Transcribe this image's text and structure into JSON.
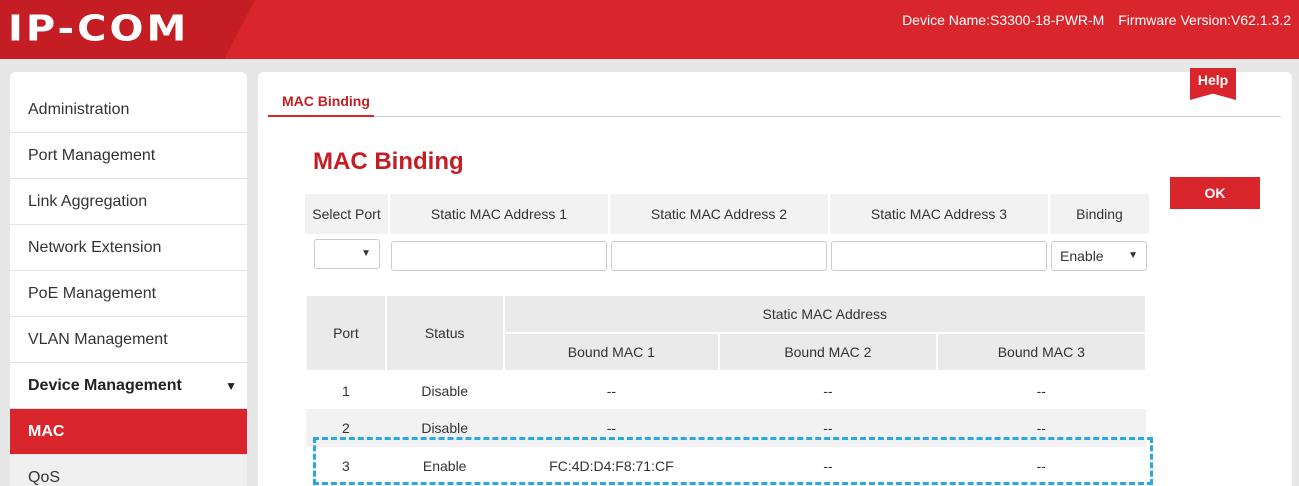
{
  "header": {
    "logo": "IP-COM",
    "device_name": "Device Name:S3300-18-PWR-M",
    "firmware": "Firmware Version:V62.1.3.2"
  },
  "sidebar": {
    "items": [
      {
        "label": "Administration"
      },
      {
        "label": "Port Management"
      },
      {
        "label": "Link Aggregation"
      },
      {
        "label": "Network Extension"
      },
      {
        "label": "PoE Management"
      },
      {
        "label": "VLAN Management"
      },
      {
        "label": "Device Management",
        "expanded": true
      },
      {
        "label": "MAC",
        "active": true
      },
      {
        "label": "QoS"
      }
    ]
  },
  "main": {
    "tab": "MAC Binding",
    "help": "Help",
    "title": "MAC Binding",
    "ok_label": "OK",
    "form": {
      "headers": [
        "Select Port",
        "Static MAC Address 1",
        "Static MAC Address 2",
        "Static MAC Address 3",
        "Binding"
      ],
      "port_value": "",
      "mac1": "",
      "mac2": "",
      "mac3": "",
      "binding_value": "Enable"
    },
    "table": {
      "col_port": "Port",
      "col_status": "Status",
      "col_group": "Static MAC Address",
      "col_mac1": "Bound MAC 1",
      "col_mac2": "Bound MAC 2",
      "col_mac3": "Bound MAC 3",
      "rows": [
        {
          "port": "1",
          "status": "Disable",
          "mac1": "--",
          "mac2": "--",
          "mac3": "--"
        },
        {
          "port": "2",
          "status": "Disable",
          "mac1": "--",
          "mac2": "--",
          "mac3": "--"
        },
        {
          "port": "3",
          "status": "Enable",
          "mac1": "FC:4D:D4:F8:71:CF",
          "mac2": "--",
          "mac3": "--"
        }
      ]
    }
  },
  "colors": {
    "brand_red": "#d8262c",
    "highlight_blue": "#29a9e0"
  }
}
